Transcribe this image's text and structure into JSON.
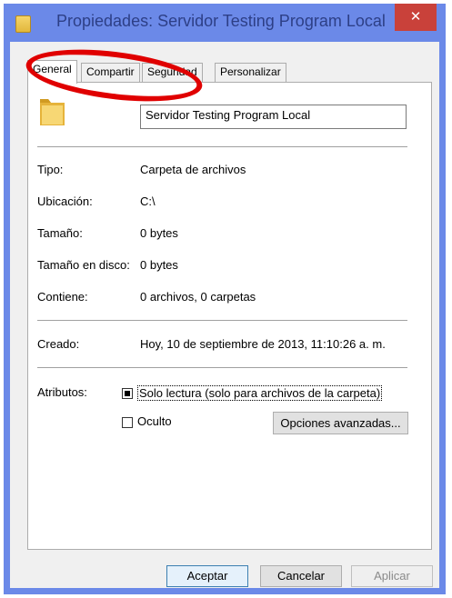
{
  "window": {
    "title": "Propiedades: Servidor Testing Program Local",
    "close_glyph": "✕"
  },
  "tabs": [
    {
      "label": "General",
      "active": true
    },
    {
      "label": "Compartir",
      "active": false
    },
    {
      "label": "Seguridad",
      "active": false
    },
    {
      "label": "Personalizar",
      "active": false
    }
  ],
  "general": {
    "folder_icon": "folder-icon",
    "name": "Servidor Testing Program Local",
    "rows": [
      {
        "label": "Tipo:",
        "value": "Carpeta de archivos"
      },
      {
        "label": "Ubicación:",
        "value": "C:\\"
      },
      {
        "label": "Tamaño:",
        "value": "0 bytes"
      },
      {
        "label": "Tamaño en disco:",
        "value": "0 bytes"
      },
      {
        "label": "Contiene:",
        "value": "0 archivos, 0 carpetas"
      }
    ],
    "created_label": "Creado:",
    "created_value": "Hoy, 10 de septiembre de 2013, 11:10:26 a. m.",
    "attributes_label": "Atributos:",
    "readonly_label": "Solo lectura (solo para archivos de la carpeta)",
    "readonly_state": "indeterminate",
    "hidden_label": "Oculto",
    "hidden_checked": false,
    "advanced_button": "Opciones avanzadas..."
  },
  "footer": {
    "ok": "Aceptar",
    "cancel": "Cancelar",
    "apply": "Aplicar"
  },
  "colors": {
    "titlebar": "#6b89e8",
    "close": "#c9413a",
    "annotation": "#e00000"
  }
}
